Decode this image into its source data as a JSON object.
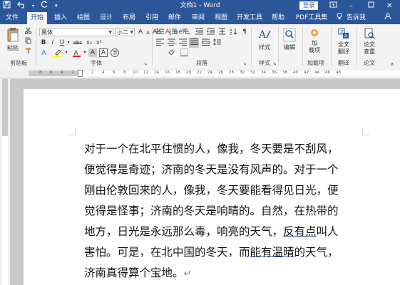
{
  "titlebar": {
    "document_title": "文档1 - Word",
    "login_label": "登录"
  },
  "tabs": [
    {
      "label": "文件"
    },
    {
      "label": "开始"
    },
    {
      "label": "插入"
    },
    {
      "label": "绘图"
    },
    {
      "label": "设计"
    },
    {
      "label": "布局"
    },
    {
      "label": "引用"
    },
    {
      "label": "邮件"
    },
    {
      "label": "审阅"
    },
    {
      "label": "视图"
    },
    {
      "label": "开发工具"
    },
    {
      "label": "帮助"
    },
    {
      "label": "PDF工具集"
    }
  ],
  "tell_me": "告诉我",
  "ribbon": {
    "clipboard": {
      "paste_label": "粘贴",
      "group_label": "剪贴板"
    },
    "font": {
      "font_name": "黑体",
      "font_size": "小二",
      "group_label": "字体",
      "bold": "B",
      "italic": "I",
      "underline": "U",
      "strikethrough": "abc",
      "subscript": "x₂",
      "superscript": "x²",
      "clear_format": "A",
      "grow_font": "A",
      "shrink_font": "A",
      "change_case": "Aa",
      "highlight": "ab",
      "font_color": "A",
      "char_shading": "A",
      "char_border": "A",
      "phonetic": "wén",
      "enclose": "字"
    },
    "paragraph": {
      "group_label": "段落"
    },
    "styles": {
      "label": "样式",
      "group_label": "样式"
    },
    "editing": {
      "label": "编辑"
    },
    "addins": {
      "label_line1": "加",
      "label_line2": "载项",
      "group_label": "加载项"
    },
    "translate": {
      "label_line1": "全文",
      "label_line2": "翻译",
      "group_label": "翻译"
    },
    "paper_check": {
      "label_line1": "论文",
      "label_line2": "查重",
      "group_label": "论文"
    }
  },
  "ruler_numbers": [
    "8",
    "6",
    "4",
    "2",
    "2",
    "4",
    "6",
    "8",
    "10",
    "12",
    "14",
    "16",
    "18",
    "20",
    "22",
    "24",
    "26",
    "28",
    "30",
    "32",
    "34",
    "36",
    "38",
    "40",
    "42",
    "44",
    "46",
    "48"
  ],
  "document": {
    "lines": [
      {
        "text": "对于一个在北平住惯的人，像我，冬天要是不刮风，"
      },
      {
        "text": "便觉得是奇迹；济南的冬天是没有风声的。对于一个"
      },
      {
        "text": "刚由伦敦回来的人，像我，冬天要能看得见日光，便"
      },
      {
        "text": "觉得是怪事；济南的冬天是响晴的。自然，在热带的"
      },
      {
        "pre": "地方，日光是永远那么毒，响亮的天气，",
        "underlined": "反有点",
        "post": "叫人"
      },
      {
        "pre": "害怕。可是，在北中国的冬天，而",
        "underlined": "能有温晴",
        "post": "的天气，"
      },
      {
        "text": "济南真得算个宝地。"
      }
    ],
    "paragraph_mark": "↵"
  }
}
